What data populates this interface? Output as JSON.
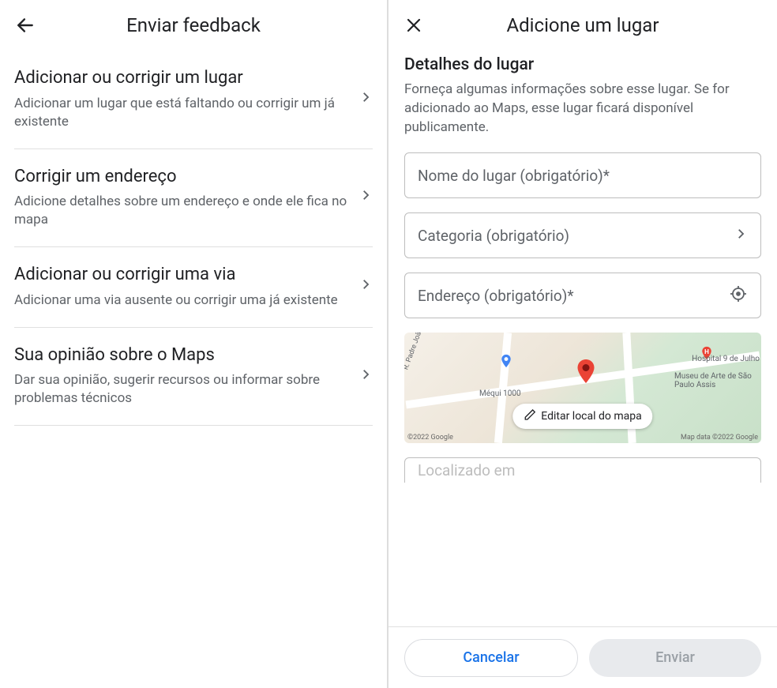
{
  "left": {
    "title": "Enviar feedback",
    "items": [
      {
        "title": "Adicionar ou corrigir um lugar",
        "sub": "Adicionar um lugar que está faltando ou corrigir um já existente"
      },
      {
        "title": "Corrigir um endereço",
        "sub": "Adicione detalhes sobre um endereço e onde ele fica no mapa"
      },
      {
        "title": "Adicionar ou corrigir uma via",
        "sub": "Adicionar uma via ausente ou corrigir uma já existente"
      },
      {
        "title": "Sua opinião sobre o Maps",
        "sub": "Dar sua opinião, sugerir recursos ou informar sobre problemas técnicos"
      }
    ]
  },
  "right": {
    "title": "Adicione um lugar",
    "section_title": "Detalhes do lugar",
    "section_desc": "Forneça algumas informações sobre esse lugar. Se for adicionado ao Maps, esse lugar ficará disponível publicamente.",
    "fields": {
      "name": "Nome do lugar (obrigatório)*",
      "category": "Categoria (obrigatório)",
      "address": "Endereço (obrigatório)*",
      "located_partial": "Localizado em"
    },
    "map": {
      "edit_label": "Editar local do mapa",
      "attr_left": "©2022 Google",
      "attr_right": "Map data ©2022 Google",
      "poi_mequi": "Méqui 1000",
      "poi_hospital": "Hospital 9 de Julho",
      "poi_museum": "Museu de Arte de São Paulo Assis",
      "poi_street": "R. Padre João Manuel"
    },
    "buttons": {
      "cancel": "Cancelar",
      "send": "Enviar"
    }
  }
}
